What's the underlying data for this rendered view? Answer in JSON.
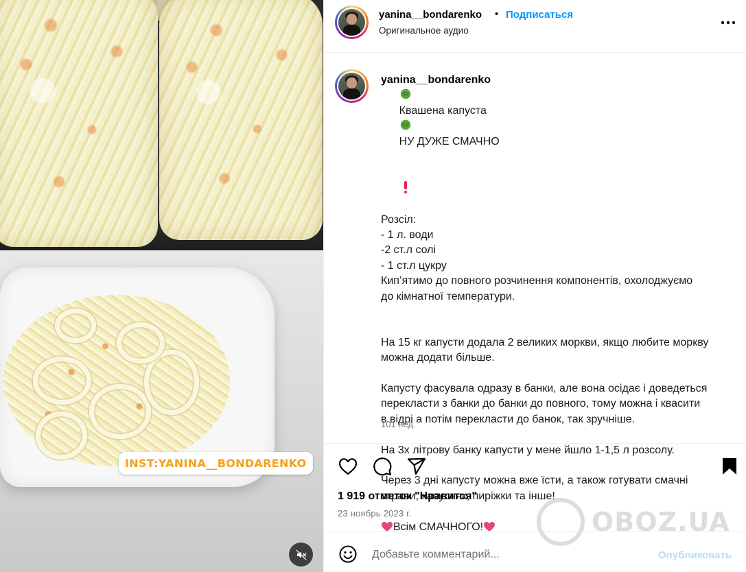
{
  "media": {
    "watermark_text": "INST:YANINA__BONDARENKO",
    "mute_icon": "speaker-muted-icon"
  },
  "header": {
    "username": "yanina__bondarenko",
    "separator": "•",
    "follow_label": "Подписаться",
    "audio_label": "Оригинальное аудио",
    "more_icon": "more-dots-icon"
  },
  "caption": {
    "username": "yanina__bondarenko",
    "title_lead": "Квашена капуста",
    "title_tail": "НУ ДУЖЕ СМАЧНО",
    "lines": [
      "Розсіл:",
      "- 1 л. води",
      "-2 ст.л солі",
      "- 1 ст.л цукру",
      "Кип’ятимо до повного розчинення компонентів, охолоджуємо",
      "до кімнатної температури."
    ],
    "paragraphs": [
      [
        "На 15 кг капусти додала 2 великих моркви, якщо любите моркву",
        "можна додати більше."
      ],
      [
        "Капусту фасувала одразу в банки, але вона осідає і доведеться",
        "перекласти з банки до банки до повного, тому можна і квасити",
        "в відрі а потім перекласти до банок, так зручніше."
      ],
      [
        "На 3х літрову банку капусти у мене йшло 1-1,5 л розсолу."
      ],
      [
        "Через 3 дні капусту можна вже їсти, а також готувати смачні",
        "страви, капусняк, пиріжки та інше!"
      ]
    ],
    "closing": "Всім СМАЧНОГО!",
    "time_ago": "101 нед."
  },
  "actions": {
    "like_icon": "heart-icon",
    "comment_icon": "comment-bubble-icon",
    "share_icon": "share-plane-icon",
    "save_icon": "bookmark-icon"
  },
  "likes_text": "1 919 отметок \"Нравится\"",
  "post_date": "23 ноябрь 2023 г.",
  "comment": {
    "placeholder": "Добавьте комментарий...",
    "publish_label": "Опубликовать"
  },
  "site_watermark": "OBOZ.UA",
  "colors": {
    "link_blue": "#0095f6",
    "publish_disabled": "#b2dffc",
    "secondary_text": "#737373",
    "watermark_orange": "#f3a21b"
  }
}
